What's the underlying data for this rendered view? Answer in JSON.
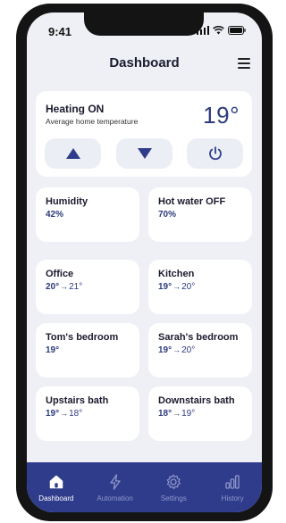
{
  "status_bar": {
    "time": "9:41"
  },
  "header": {
    "title": "Dashboard"
  },
  "heating": {
    "title": "Heating ON",
    "subtitle": "Average home temperature",
    "temperature": "19°"
  },
  "tiles": [
    {
      "name": "Humidity",
      "current": "42%",
      "target": ""
    },
    {
      "name": "Hot water OFF",
      "current": "70%",
      "target": ""
    },
    {
      "name": "Office",
      "current": "20°",
      "target": "21°"
    },
    {
      "name": "Kitchen",
      "current": "19°",
      "target": "20°"
    },
    {
      "name": "Tom's bedroom",
      "current": "19°",
      "target": ""
    },
    {
      "name": "Sarah's bedroom",
      "current": "19°",
      "target": "20°"
    },
    {
      "name": "Upstairs bath",
      "current": "19°",
      "target": "18°"
    },
    {
      "name": "Downstairs bath",
      "current": "18°",
      "target": "19°"
    }
  ],
  "tabbar": {
    "items": [
      {
        "label": "Dashboard",
        "icon": "home-icon",
        "active": true
      },
      {
        "label": "Automation",
        "icon": "lightning-icon",
        "active": false
      },
      {
        "label": "Settings",
        "icon": "gear-icon",
        "active": false
      },
      {
        "label": "History",
        "icon": "bar-chart-icon",
        "active": false
      }
    ]
  },
  "colors": {
    "accent": "#2f3c8c",
    "value_text": "#2d3a7c",
    "background": "#eef0f6",
    "card": "#ffffff",
    "button_bg": "#eceef5"
  }
}
